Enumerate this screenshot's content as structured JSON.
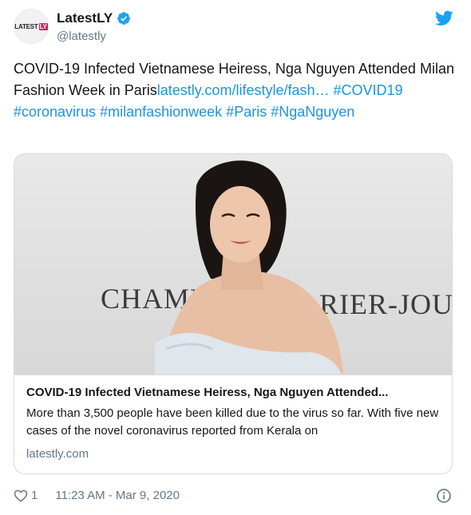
{
  "account": {
    "display_name": "LatestLY",
    "handle": "@latestly",
    "avatar_logo_text": "LATEST",
    "avatar_logo_badge": "LY"
  },
  "tweet": {
    "text_plain_1": "COVID-19 Infected Vietnamese Heiress, Nga Nguyen Attended Milan Fashion Week in Paris",
    "link_text": "latestly.com/lifestyle/fash…",
    "hashtags": [
      "#COVID19",
      "#coronavirus",
      "#milanfashionweek",
      "#Paris",
      "#NgaNguyen"
    ]
  },
  "card": {
    "image_text_left": "CHAMPA",
    "image_text_right": "RIER-JOUËT",
    "title": "COVID-19 Infected Vietnamese Heiress, Nga Nguyen Attended...",
    "description": "More than 3,500 people have been killed due to the virus so far. With five new cases of the novel coronavirus reported from Kerala on",
    "domain": "latestly.com"
  },
  "footer": {
    "like_count": "1",
    "timestamp": "11:23 AM - Mar 9, 2020"
  },
  "icons": {
    "verified": "verified-badge-icon",
    "bird": "twitter-bird-icon",
    "heart": "heart-icon",
    "info": "info-icon"
  },
  "colors": {
    "link": "#1b95e0",
    "verified": "#1da1f2",
    "secondary_text": "#657786",
    "avatar_badge": "#d81b60"
  }
}
